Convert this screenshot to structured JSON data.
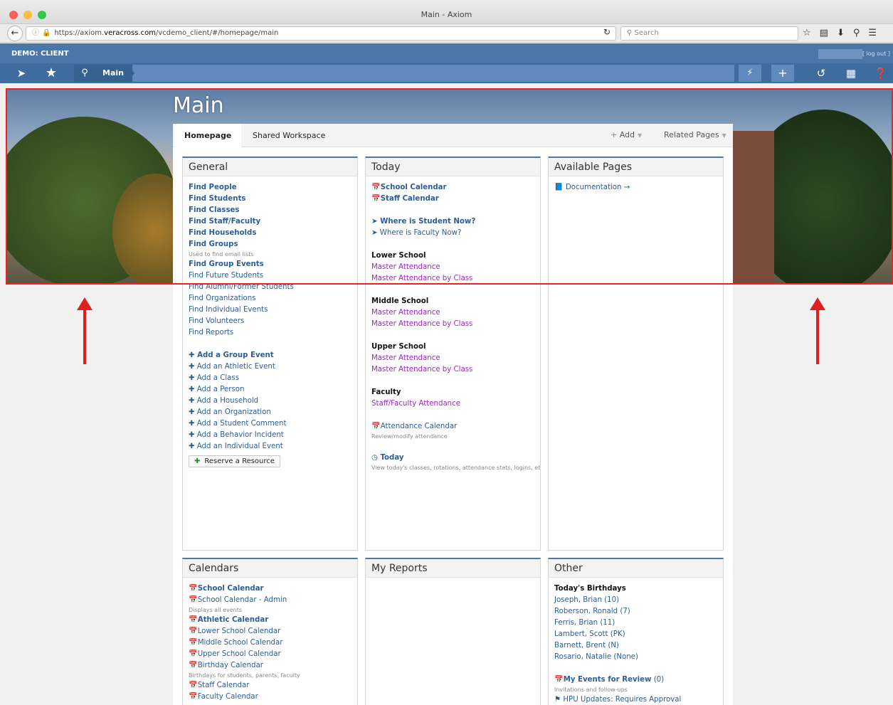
{
  "window": {
    "title": "Main - Axiom"
  },
  "browser": {
    "url_prefix": "https://axiom.",
    "url_host": "veracross.com",
    "url_path": "/vcdemo_client/#/homepage/main",
    "search_placeholder": "Search"
  },
  "app": {
    "client_label": "DEMO: CLIENT",
    "logout_label": "[ log out ]",
    "breadcrumb": "Main"
  },
  "hero": {
    "title": "Main"
  },
  "tabs": {
    "homepage": "Homepage",
    "shared": "Shared Workspace",
    "add": "Add",
    "related": "Related Pages"
  },
  "general": {
    "title": "General",
    "find": [
      {
        "label": "Find People",
        "bold": true
      },
      {
        "label": "Find Students",
        "bold": true
      },
      {
        "label": "Find Classes",
        "bold": true
      },
      {
        "label": "Find Staff/Faculty",
        "bold": true
      },
      {
        "label": "Find Households",
        "bold": true
      },
      {
        "label": "Find Groups",
        "bold": true
      }
    ],
    "groups_note": "Used to find email lists",
    "find2": [
      {
        "label": "Find Group Events",
        "bold": true
      },
      {
        "label": "Find Future Students",
        "bold": false
      },
      {
        "label": "Find Alumni/Former Students",
        "bold": false
      },
      {
        "label": "Find Organizations",
        "bold": false
      },
      {
        "label": "Find Individual Events",
        "bold": false
      },
      {
        "label": "Find Volunteers",
        "bold": false
      },
      {
        "label": "Find Reports",
        "bold": false
      }
    ],
    "add": [
      {
        "label": "Add a Group Event",
        "bold": true
      },
      {
        "label": "Add an Athletic Event",
        "bold": false
      },
      {
        "label": "Add a Class",
        "bold": false
      },
      {
        "label": "Add a Person",
        "bold": false
      },
      {
        "label": "Add a Household",
        "bold": false
      },
      {
        "label": "Add an Organization",
        "bold": false
      },
      {
        "label": "Add a Student Comment",
        "bold": false
      },
      {
        "label": "Add a Behavior Incident",
        "bold": false
      },
      {
        "label": "Add an Individual Event",
        "bold": false
      }
    ],
    "reserve": "Reserve a Resource"
  },
  "today": {
    "title": "Today",
    "school_calendar": "School Calendar",
    "staff_calendar": "Staff Calendar",
    "where_student": "Where is Student Now?",
    "where_faculty": "Where is Faculty Now?",
    "lower": "Lower School",
    "middle": "Middle School",
    "upper": "Upper School",
    "master": "Master Attendance",
    "master_class": "Master Attendance by Class",
    "faculty": "Faculty",
    "staff_att": "Staff/Faculty Attendance",
    "att_cal": "Attendance Calendar",
    "att_note": "Review/modify attendance",
    "today_link": "Today",
    "today_note": "View today's classes, rotations, attendance stats, logins, etc."
  },
  "available": {
    "title": "Available Pages",
    "doc": "Documentation →"
  },
  "calendars": {
    "title": "Calendars",
    "items": [
      {
        "label": "School Calendar",
        "bold": true,
        "icon": "orange",
        "note": ""
      },
      {
        "label": "School Calendar - Admin",
        "bold": false,
        "icon": "orange",
        "note": "Displays all events"
      },
      {
        "label": "Athletic Calendar",
        "bold": true,
        "icon": "blue",
        "note": ""
      },
      {
        "label": "Lower School Calendar",
        "bold": false,
        "icon": "orange",
        "note": ""
      },
      {
        "label": "Middle School Calendar",
        "bold": false,
        "icon": "orange",
        "note": ""
      },
      {
        "label": "Upper School Calendar",
        "bold": false,
        "icon": "orange",
        "note": ""
      },
      {
        "label": "Birthday Calendar",
        "bold": false,
        "icon": "orange",
        "note": "Birthdays for students, parents, faculty"
      },
      {
        "label": "Staff Calendar",
        "bold": false,
        "icon": "blue",
        "note": ""
      },
      {
        "label": "Faculty Calendar",
        "bold": false,
        "icon": "blue",
        "note": ""
      }
    ]
  },
  "reports": {
    "title": "My Reports"
  },
  "other": {
    "title": "Other",
    "birthdays_title": "Today's Birthdays",
    "birthdays": [
      "Joseph, Brian (10)",
      "Roberson, Ronald (7)",
      "Ferris, Brian (11)",
      "Lambert, Scott (PK)",
      "Barnett, Brent (N)",
      "Rosario, Natalie (None)"
    ],
    "events_review": "My Events for Review",
    "events_count": "(0)",
    "events_note": "Invitations and follow-ups",
    "hpu": "HPU Updates: Requires Approval"
  },
  "colors": {
    "header_blue": "#4a76a8",
    "link_blue": "#2c5d97",
    "purple": "#a026c0",
    "annotation_red": "#e01f1f"
  }
}
